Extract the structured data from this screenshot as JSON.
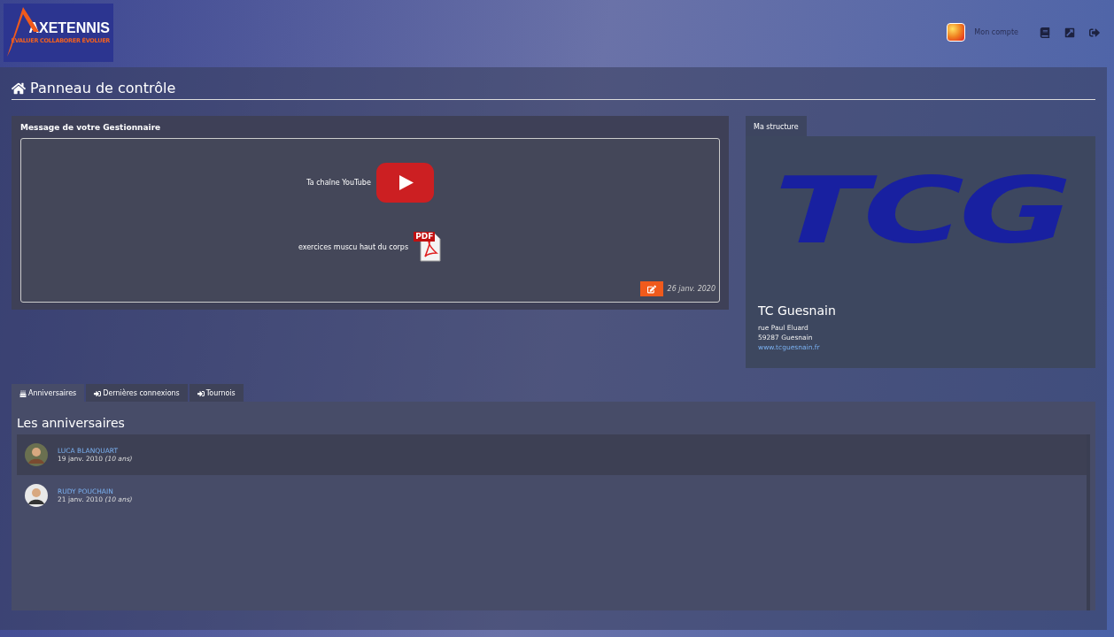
{
  "header": {
    "logo": {
      "name": "AXETENNIS",
      "tagline": "ÉVALUER COLLABORER ÉVOLUER"
    },
    "account_label": "Mon compte"
  },
  "page_title": "Panneau de contrôle",
  "message_panel": {
    "title": "Message de votre Gestionnaire",
    "items": [
      {
        "kind": "video",
        "label": "Ta chaîne YouTube"
      },
      {
        "kind": "pdf",
        "label": "exercices muscu haut du corps",
        "badge": "PDF"
      }
    ],
    "date": "26 janv. 2020"
  },
  "structure": {
    "tab": "Ma structure",
    "logo_text": "TCG",
    "name": "TC Guesnain",
    "address": [
      "rue Paul Eluard",
      "59287 Guesnain"
    ],
    "website": "www.tcguesnain.fr"
  },
  "tabs": [
    {
      "label": "Anniversaires",
      "kind": "cake",
      "selected": true
    },
    {
      "label": "Dernières connexions",
      "kind": "login",
      "selected": false
    },
    {
      "label": "Tournois",
      "kind": "login",
      "selected": false
    }
  ],
  "birthdays": {
    "title": "Les anniversaires",
    "rows": [
      {
        "name": "LUCA BLANQUART",
        "date": "19 janv. 2010",
        "age": "(10 ans)",
        "highlighted": true
      },
      {
        "name": "RUDY POUCHAIN",
        "date": "21 janv. 2010",
        "age": "(10 ans)",
        "highlighted": false
      }
    ]
  }
}
